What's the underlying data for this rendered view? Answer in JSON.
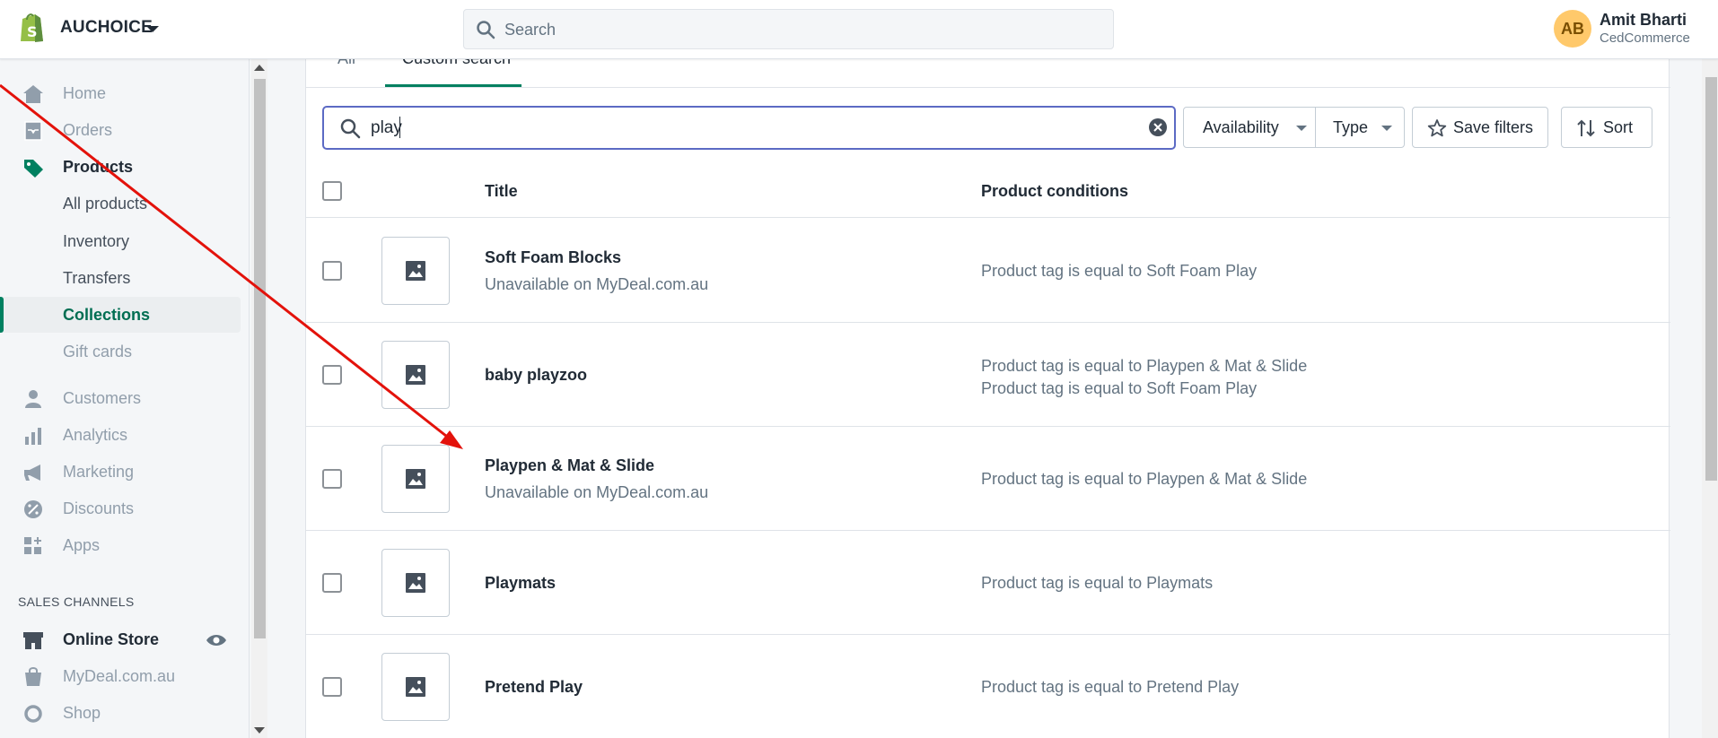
{
  "header": {
    "store_name": "AUCHOICE",
    "search_placeholder": "Search",
    "user": {
      "initials": "AB",
      "name": "Amit Bharti",
      "store": "CedCommerce"
    }
  },
  "sidebar": {
    "items": [
      {
        "label": "Home",
        "icon": "home-icon"
      },
      {
        "label": "Orders",
        "icon": "orders-icon"
      },
      {
        "label": "Products",
        "icon": "tag-icon"
      },
      {
        "label": "All products"
      },
      {
        "label": "Inventory"
      },
      {
        "label": "Transfers"
      },
      {
        "label": "Collections"
      },
      {
        "label": "Gift cards"
      },
      {
        "label": "Customers",
        "icon": "customer-icon"
      },
      {
        "label": "Analytics",
        "icon": "analytics-icon"
      },
      {
        "label": "Marketing",
        "icon": "megaphone-icon"
      },
      {
        "label": "Discounts",
        "icon": "discount-icon"
      },
      {
        "label": "Apps",
        "icon": "apps-icon"
      }
    ],
    "sales_channels_heading": "SALES CHANNELS",
    "channels": [
      {
        "label": "Online Store",
        "icon": "store-icon"
      },
      {
        "label": "MyDeal.com.au",
        "icon": "bag-icon"
      },
      {
        "label": "Shop",
        "icon": "shop-icon"
      }
    ]
  },
  "tabs": {
    "all": "All",
    "custom": "Custom search"
  },
  "filters": {
    "search_value": "play",
    "availability": "Availability",
    "type": "Type",
    "save_filters": "Save filters",
    "sort": "Sort"
  },
  "table": {
    "columns": {
      "title": "Title",
      "conditions": "Product conditions"
    },
    "rows": [
      {
        "title": "Soft Foam Blocks",
        "subtitle": "Unavailable on MyDeal.com.au",
        "conditions": [
          "Product tag is equal to Soft Foam Play"
        ]
      },
      {
        "title": "baby playzoo",
        "subtitle": "",
        "conditions": [
          "Product tag is equal to Playpen & Mat & Slide",
          "Product tag is equal to Soft Foam Play"
        ]
      },
      {
        "title": "Playpen & Mat & Slide",
        "subtitle": "Unavailable on MyDeal.com.au",
        "conditions": [
          "Product tag is equal to Playpen & Mat & Slide"
        ]
      },
      {
        "title": "Playmats",
        "subtitle": "",
        "conditions": [
          "Product tag is equal to Playmats"
        ]
      },
      {
        "title": "Pretend Play",
        "subtitle": "",
        "conditions": [
          "Product tag is equal to Pretend Play"
        ]
      }
    ]
  },
  "colors": {
    "accent": "#008060",
    "focus": "#5c6ac4",
    "annotation": "#e3120b"
  }
}
